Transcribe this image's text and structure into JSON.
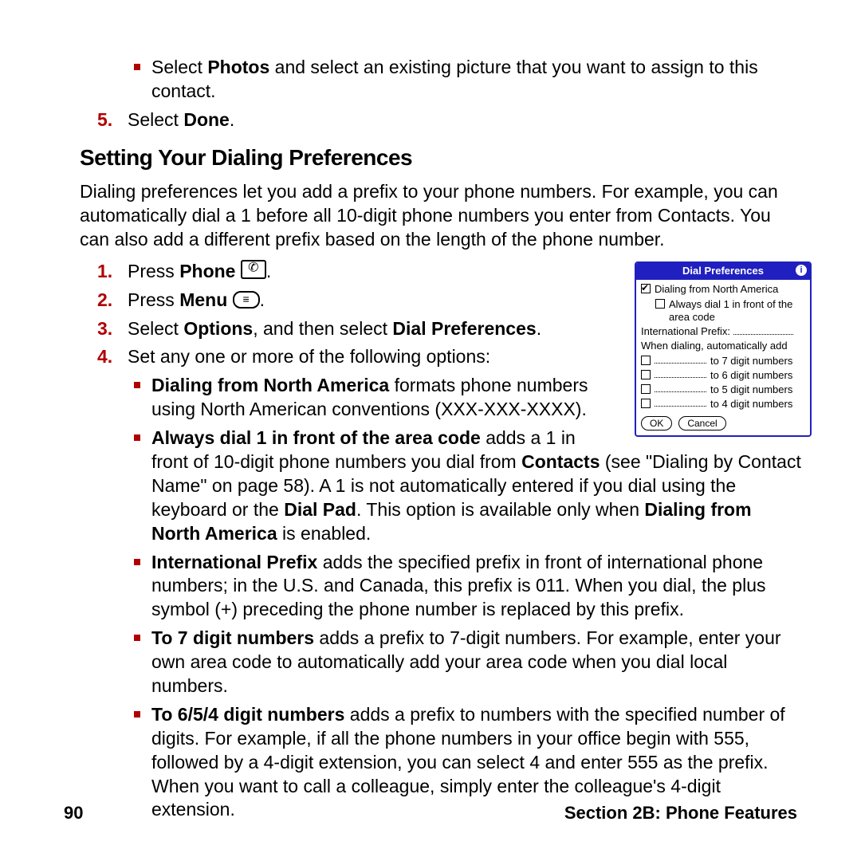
{
  "top_bullets": {
    "photos_line": [
      "Select ",
      "Photos",
      " and select an existing picture that you want to assign to this contact."
    ]
  },
  "step5": {
    "num": "5.",
    "text_pre": "Select ",
    "bold": "Done",
    "text_post": "."
  },
  "heading": "Setting Your Dialing Preferences",
  "intro": "Dialing preferences let you add a prefix to your phone numbers. For example, you can automatically dial a 1 before all 10-digit phone numbers you enter from Contacts. You can also add a different prefix based on the length of the phone number.",
  "steps": {
    "s1": {
      "num": "1.",
      "pre": "Press ",
      "bold": "Phone",
      "post": " ",
      "trail": "."
    },
    "s2": {
      "num": "2.",
      "pre": "Press ",
      "bold": "Menu",
      "post": " ",
      "trail": "."
    },
    "s3": {
      "num": "3.",
      "pre": "Select ",
      "b1": "Options",
      "mid": ", and then select ",
      "b2": "Dial Preferences",
      "post": "."
    },
    "s4": {
      "num": "4.",
      "text": "Set any one or more of the following options:"
    }
  },
  "opts": {
    "na": {
      "b": "Dialing from North America",
      "rest": " formats phone numbers using North American conventions (XXX-XXX-XXXX)."
    },
    "always1": {
      "b1": "Always dial 1 in front of the area code",
      "t1": " adds a 1 in front of 10-digit phone numbers you dial from ",
      "b2": "Contacts",
      "t2": " (see \"Dialing by Contact Name\" on page 58). A 1 is not automatically entered if you dial using the keyboard or the ",
      "b3": "Dial Pad",
      "t3": ". This option is available only when ",
      "b4": "Dialing from North America",
      "t4": " is enabled."
    },
    "intl": {
      "b": "International Prefix",
      "rest": " adds the specified prefix in front of international phone numbers; in the U.S. and Canada, this prefix is 011. When you dial, the plus symbol (+) preceding the phone number is replaced by this prefix."
    },
    "seven": {
      "b": "To 7 digit numbers",
      "rest": " adds a prefix to 7-digit numbers. For example, enter your own area code to automatically add your area code when you dial local numbers."
    },
    "sixfive": {
      "b": "To 6/5/4 digit numbers",
      "rest": " adds a prefix to numbers with the specified number of digits. For example, if all the phone numbers in your office begin with 555, followed by a 4-digit extension, you can select 4 and enter 555 as the prefix. When you want to call a colleague, simply enter the colleague's 4-digit extension."
    }
  },
  "dialprefs_panel": {
    "title": "Dial Preferences",
    "row1": "Dialing from North America",
    "row2": "Always dial 1 in front of the area code",
    "intl_label": "International Prefix:",
    "auto_label": "When dialing, automatically add",
    "d7": "to 7 digit numbers",
    "d6": "to 6 digit numbers",
    "d5": "to 5 digit numbers",
    "d4": "to 4 digit numbers",
    "ok": "OK",
    "cancel": "Cancel"
  },
  "footer": {
    "page": "90",
    "section": "Section 2B: Phone Features"
  }
}
